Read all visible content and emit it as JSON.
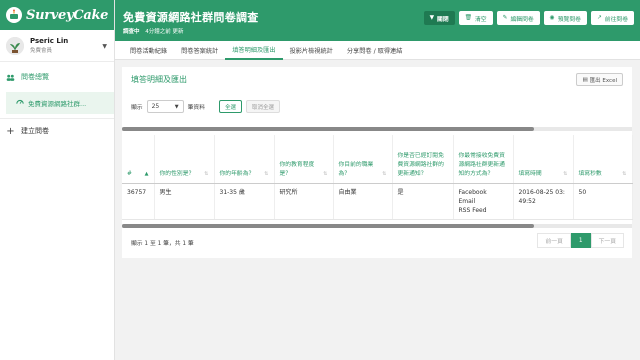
{
  "app": {
    "logo_text": "SurveyCake"
  },
  "user": {
    "name": "Pseric Lin",
    "role": "免費會員"
  },
  "sidebar": {
    "items": [
      {
        "label": "問卷總覽",
        "icon": "group-icon"
      },
      {
        "label": "免費資源網路社群...",
        "icon": "dashboard-icon"
      },
      {
        "label": "建立問卷",
        "icon": "plus-icon"
      }
    ]
  },
  "header": {
    "title": "免費資源網路社群問卷調查",
    "status": "調查中",
    "updated": "4分鐘之前 更新",
    "actions": [
      {
        "label": "關閉",
        "icon": "filter-icon"
      },
      {
        "label": "清空",
        "icon": "trash-icon"
      },
      {
        "label": "編輯問卷",
        "icon": "edit-icon"
      },
      {
        "label": "預覽問卷",
        "icon": "eye-icon"
      },
      {
        "label": "前往問卷",
        "icon": "external-link-icon"
      }
    ]
  },
  "tabs": [
    {
      "label": "問卷活動紀錄"
    },
    {
      "label": "問卷答案統計"
    },
    {
      "label": "填答明細及匯出"
    },
    {
      "label": "投影片檢視統計"
    },
    {
      "label": "分享問卷 / 取得連結"
    }
  ],
  "panel": {
    "title": "填答明細及匯出",
    "export_label": "匯出 Excel",
    "show_label": "顯示",
    "page_size": "25",
    "records_label": "筆資料",
    "select_all": "全選",
    "deselect_all": "取消全選"
  },
  "table": {
    "columns": [
      "#",
      "你的性別是？",
      "你的年齡為？",
      "你的教育程度是？",
      "你目前的職業為？",
      "你是否已經訂閱免費資源網路社群的更新通知？",
      "你最常接收免費資源網路社群更新通知的方式為？",
      "填寫時間",
      "填寫秒數"
    ],
    "rows": [
      {
        "id": "36757",
        "gender": "男生",
        "age": "31-35 歲",
        "education": "研究所",
        "job": "自由業",
        "subscribed": "是",
        "method": "Facebook\nEmail\nRSS Feed",
        "time": "2016-08-25 03:49:52",
        "seconds": "50"
      }
    ]
  },
  "footer": {
    "summary": "顯示 1 至 1 筆，共 1 筆",
    "prev": "前一頁",
    "page": "1",
    "next": "下一頁"
  },
  "colors": {
    "brand": "#2e9a6b",
    "brand_dark": "#1f7a52"
  }
}
